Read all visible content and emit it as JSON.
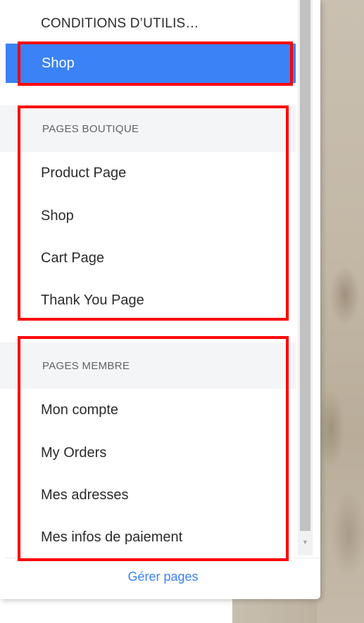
{
  "pages_menu": {
    "top_item": {
      "label": "CONDITIONS D’UTILIS…"
    },
    "selected_item": {
      "label": "Shop"
    },
    "sections": [
      {
        "header": "PAGES BOUTIQUE",
        "items": [
          {
            "label": "Product Page"
          },
          {
            "label": "Shop"
          },
          {
            "label": "Cart Page"
          },
          {
            "label": "Thank You Page"
          }
        ]
      },
      {
        "header": "PAGES MEMBRE",
        "items": [
          {
            "label": "Mon compte"
          },
          {
            "label": "My Orders"
          },
          {
            "label": "Mes adresses"
          },
          {
            "label": "Mes infos de paiement"
          }
        ]
      }
    ],
    "footer_link": "Gérer pages"
  },
  "colors": {
    "accent": "#3b82f6",
    "highlight_border": "#ff0000",
    "section_bg": "#f4f5f7"
  },
  "icons": {
    "scroll_down": "triangle-down"
  }
}
